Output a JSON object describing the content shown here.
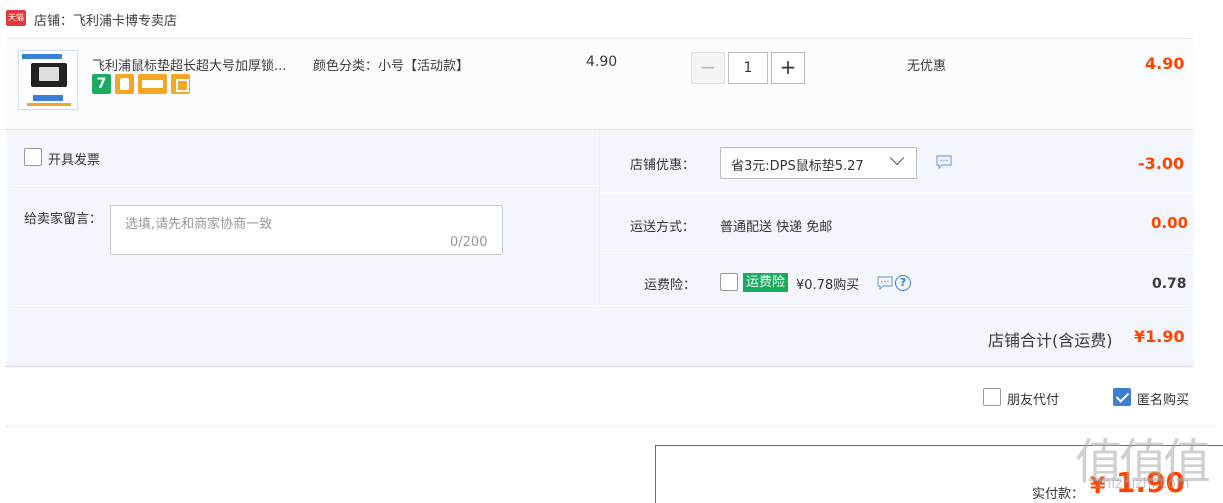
{
  "shop": {
    "badge": "天猫",
    "label": "店铺：飞利浦卡博专卖店"
  },
  "product": {
    "title": "飞利浦鼠标垫超长超大号加厚锁...",
    "sku": "颜色分类：小号【活动款】",
    "service_seven": "7",
    "unit_price": "4.90",
    "qty_minus": "−",
    "quantity": "1",
    "qty_plus": "+",
    "discount": "无优惠",
    "subtotal": "4.90"
  },
  "options": {
    "invoice_label": "开具发票",
    "memo_label": "给卖家留言：",
    "memo_placeholder": "选填,请先和商家协商一致",
    "memo_count": "0/200",
    "shop_discount_label": "店铺优惠：",
    "shop_discount_value": "省3元:DPS鼠标垫5.27",
    "shop_discount_amount": "-3.00",
    "shipping_label": "运送方式：",
    "shipping_method": "普通配送 快递 免邮",
    "shipping_amount": "0.00",
    "insurance_label": "运费险：",
    "insurance_tag": "运费险",
    "insurance_price": "¥0.78购买",
    "help": "?",
    "insurance_amount": "0.78",
    "total_label": "店铺合计(含运费)",
    "total_amount": "¥1.90"
  },
  "bottom": {
    "friend_pay": "朋友代付",
    "anonymous": "匿名购买",
    "anonymous_checked": true,
    "pay_label": "实付款：",
    "pay_currency": "¥",
    "pay_amount": "1.90"
  },
  "watermark": {
    "text": "值值值",
    "url": "zhizhizhi.com"
  },
  "colors": {
    "price_red": "#ff4400",
    "accent_blue": "#3d7fd6",
    "service_green": "#1aac5e",
    "panel_bg": "#f3f7fd"
  }
}
